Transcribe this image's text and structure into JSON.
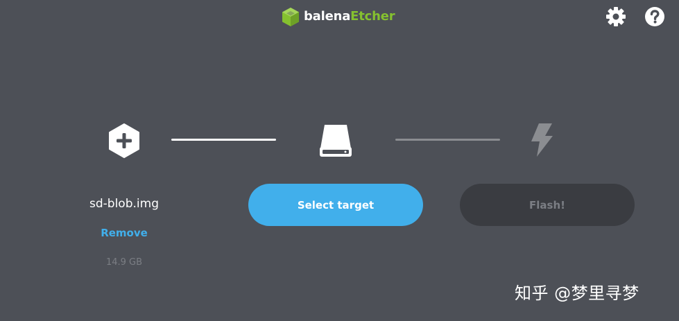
{
  "app": {
    "brand": "balena",
    "product": "Etcher"
  },
  "header": {
    "settings_icon": "gear-icon",
    "help_icon": "question-circle-icon"
  },
  "steps": {
    "source": {
      "icon": "plus-hexagon-icon",
      "file_name": "sd-blob.img",
      "remove_label": "Remove",
      "size": "14.9 GB"
    },
    "target": {
      "icon": "drive-icon",
      "button_label": "Select target"
    },
    "flash": {
      "icon": "lightning-bolt-icon",
      "button_label": "Flash!"
    }
  },
  "watermark": {
    "text": "知乎 @梦里寻梦"
  },
  "colors": {
    "background": "#4d5057",
    "accent": "#41afeb",
    "brand_green": "#85c12f",
    "disabled_button": "#3a3c41",
    "muted_text": "#7b7e84"
  }
}
